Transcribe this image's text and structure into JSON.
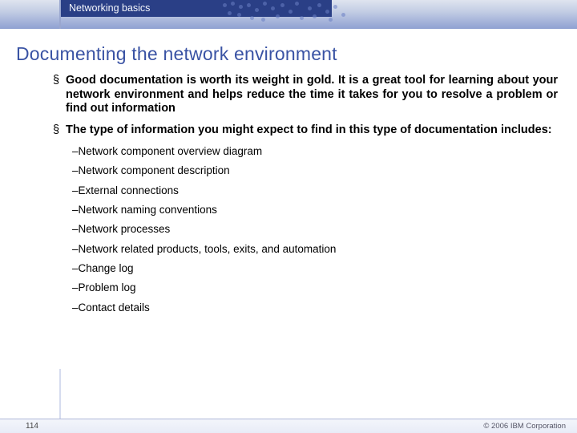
{
  "header": {
    "breadcrumb": "Networking basics"
  },
  "title": "Documenting the network environment",
  "bullets": [
    "Good documentation is worth its weight in gold.  It is a great tool for learning about your network environment and helps reduce the time it takes for you to resolve a problem or find out information",
    "The type of information you might expect to find in this type of documentation includes:"
  ],
  "subitems": [
    "–Network component overview diagram",
    "–Network component description",
    "–External connections",
    "–Network naming conventions",
    "–Network processes",
    "–Network related products, tools, exits, and automation",
    "–Change log",
    "–Problem log",
    "–Contact details"
  ],
  "footer": {
    "page": "114",
    "copyright": "© 2006 IBM Corporation"
  }
}
